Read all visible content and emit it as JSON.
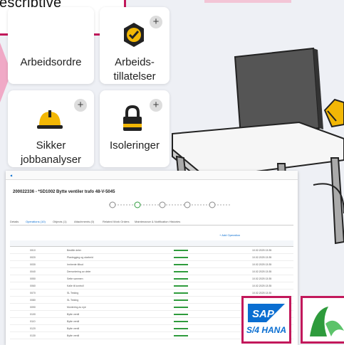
{
  "header": {
    "descriptive": "escriptive"
  },
  "tiles": [
    {
      "label1": "Arbeidsordre",
      "label2": ""
    },
    {
      "label1": "Arbeids-",
      "label2": "tillatelser"
    },
    {
      "label1": "Sikker",
      "label2": "jobbanalyser"
    },
    {
      "label1": "Isoleringer",
      "label2": ""
    }
  ],
  "plus": "+",
  "screenshot": {
    "title": "200022336 - *SD1002 Bytte ventiler trafo 48-V-5045",
    "tabs": [
      "Details",
      "Operations (10)",
      "Objects (1)",
      "Attachments (0)",
      "Related Work Orders",
      "Maintenance & Notification Histories"
    ],
    "toolbar_right": "+ Add Operation",
    "rows": [
      {
        "op": "0010",
        "desc": "Bestille deler",
        "date": "10.02.2025 13:35"
      },
      {
        "op": "0020",
        "desc": "Planlegging og utarbeid",
        "date": "10.02.2025 13:35"
      },
      {
        "op": "0030",
        "desc": "Innhente tilbud",
        "date": "10.02.2025 13:35"
      },
      {
        "op": "0040",
        "desc": "Demontering av deler",
        "date": "10.02.2025 13:35"
      },
      {
        "op": "0050",
        "desc": "Sette sammen",
        "date": "10.02.2025 13:35"
      },
      {
        "op": "0060",
        "desc": "Kalle til kontroll",
        "date": "10.02.2025 13:35"
      },
      {
        "op": "0070",
        "desc": "SL Testing",
        "date": "10.02.2025 13:35"
      },
      {
        "op": "0080",
        "desc": "SL Testing",
        "date": "10.02.2025 13:35"
      },
      {
        "op": "0090",
        "desc": "Montering av nye",
        "date": "10.02.2025 13:35"
      },
      {
        "op": "0100",
        "desc": "Bytte ventil",
        "date": "10.02.2025 13:35"
      },
      {
        "op": "0110",
        "desc": "Bytte ventil",
        "date": "10.02.2025 13:35"
      },
      {
        "op": "0120",
        "desc": "Bytte ventil",
        "date": "10.02.2025 13:35"
      },
      {
        "op": "0130",
        "desc": "Bytte ventil",
        "date": "10.02.2025 13:35"
      }
    ]
  },
  "logos": {
    "sap": "SAP",
    "sap_sub": "S/4 HANA"
  },
  "colors": {
    "accent": "#c2185b",
    "sap_blue": "#0a6ed1",
    "green": "#2e9b3c"
  }
}
